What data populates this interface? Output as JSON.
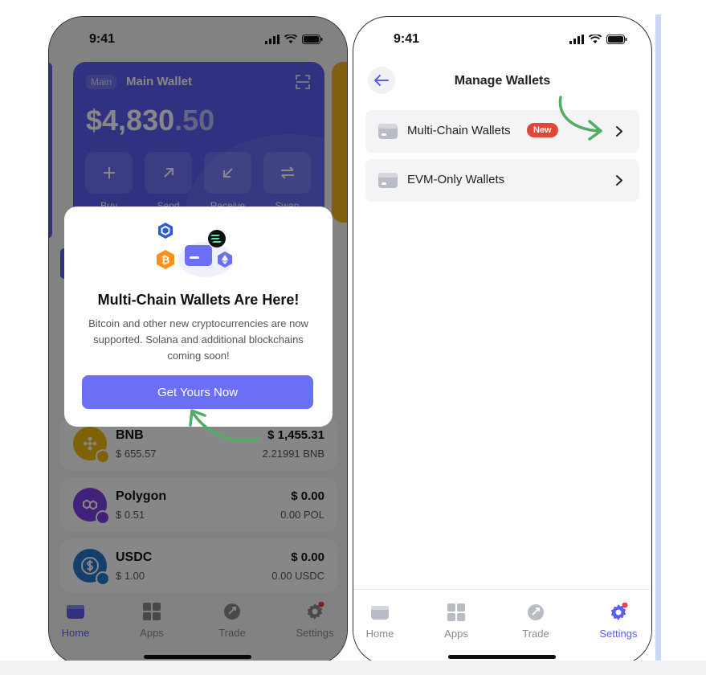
{
  "left_phone": {
    "status_time": "9:41",
    "wallet_card": {
      "tag": "Main",
      "name": "Main Wallet",
      "balance_main": "$4,830",
      "balance_cents": ".50",
      "actions": [
        {
          "label": "Buy",
          "icon": "plus-icon"
        },
        {
          "label": "Send",
          "icon": "arrow-up-right-icon"
        },
        {
          "label": "Receive",
          "icon": "arrow-down-left-icon"
        },
        {
          "label": "Swap",
          "icon": "swap-icon"
        }
      ]
    },
    "assets": [
      {
        "name": "BNB",
        "price": "$ 655.57",
        "value": "$ 1,455.31",
        "amount": "2.21991 BNB",
        "color": "#f0b90b"
      },
      {
        "name": "Polygon",
        "price": "$ 0.51",
        "value": "$ 0.00",
        "amount": "0.00 POL",
        "color": "#7b3fe4"
      },
      {
        "name": "USDC",
        "price": "$ 1.00",
        "value": "$ 0.00",
        "amount": "0.00 USDC",
        "color": "#2775ca"
      }
    ],
    "tabs": [
      {
        "label": "Home",
        "icon": "wallet-icon",
        "active": true
      },
      {
        "label": "Apps",
        "icon": "apps-grid-icon",
        "active": false
      },
      {
        "label": "Trade",
        "icon": "trade-icon",
        "active": false
      },
      {
        "label": "Settings",
        "icon": "gear-icon",
        "active": false
      }
    ],
    "modal": {
      "title": "Multi-Chain Wallets Are Here!",
      "description": "Bitcoin and other new cryptocurrencies are now supported. Solana and additional blockchains coming soon!",
      "button_label": "Get Yours Now",
      "illustration_icons": [
        "chainlink-icon",
        "solana-icon",
        "bitcoin-icon",
        "ethereum-icon",
        "wallet-card-icon"
      ]
    }
  },
  "right_phone": {
    "status_time": "9:41",
    "title": "Manage Wallets",
    "wallet_options": [
      {
        "label": "Multi-Chain Wallets",
        "badge": "New"
      },
      {
        "label": "EVM-Only Wallets",
        "badge": ""
      }
    ],
    "tabs": [
      {
        "label": "Home",
        "icon": "wallet-icon",
        "active": false
      },
      {
        "label": "Apps",
        "icon": "apps-grid-icon",
        "active": false
      },
      {
        "label": "Trade",
        "icon": "trade-icon",
        "active": false
      },
      {
        "label": "Settings",
        "icon": "gear-icon",
        "active": true
      }
    ]
  },
  "colors": {
    "accent": "#5b5ef3",
    "button": "#6b6ff3",
    "badge": "#e0473a",
    "annotation_arrow": "#4fae63"
  }
}
